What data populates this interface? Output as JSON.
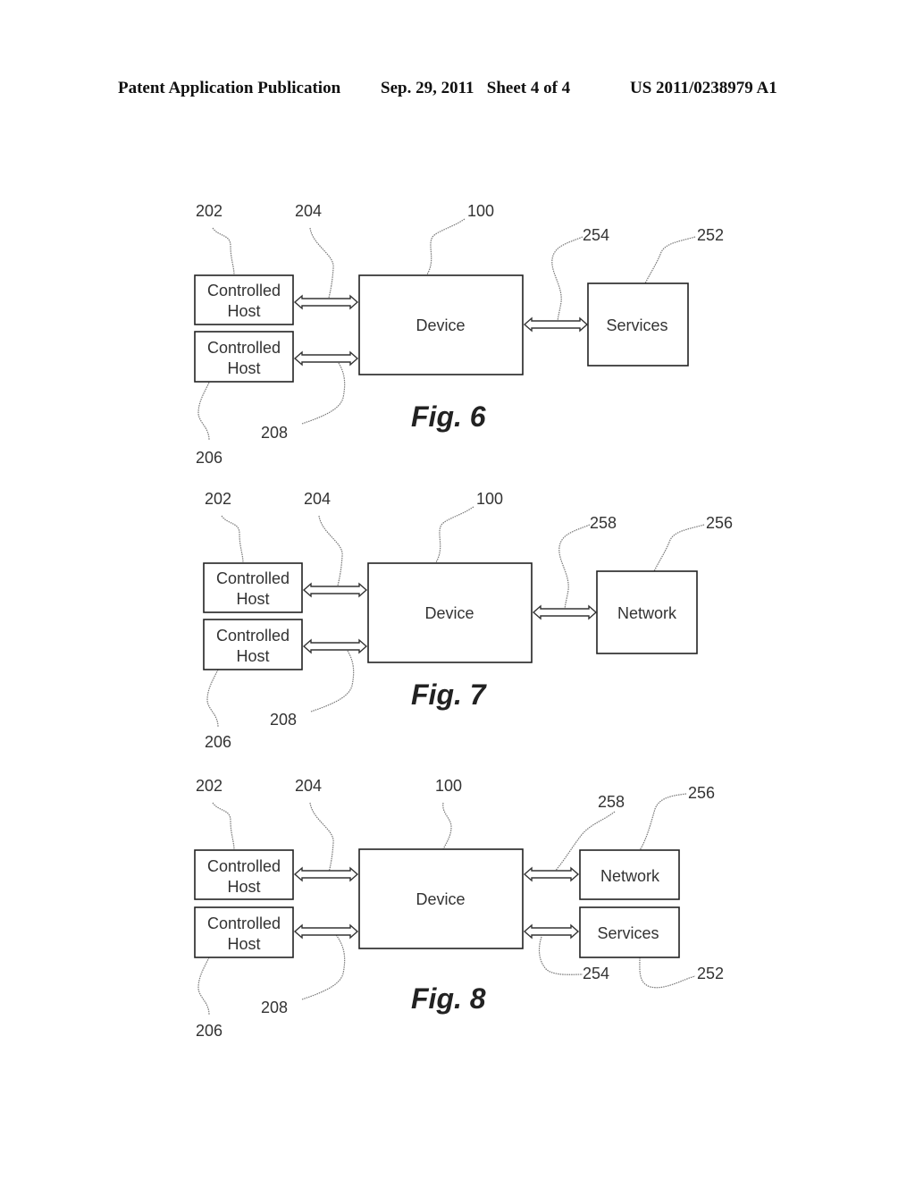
{
  "header": {
    "publication": "Patent Application Publication",
    "date_sheet": "Sep. 29, 2011   Sheet 4 of 4",
    "number": "US 2011/0238979 A1"
  },
  "figures": [
    {
      "caption": "Fig. 6",
      "boxes": {
        "host_top": [
          "Controlled",
          "Host"
        ],
        "host_bottom": [
          "Controlled",
          "Host"
        ],
        "device": "Device",
        "right": [
          "Services"
        ]
      },
      "refs": {
        "host_top": "202",
        "link_top": "204",
        "device": "100",
        "host_bottom": "206",
        "link_bottom": "208",
        "right_link": "254",
        "right_box": "252"
      }
    },
    {
      "caption": "Fig. 7",
      "boxes": {
        "host_top": [
          "Controlled",
          "Host"
        ],
        "host_bottom": [
          "Controlled",
          "Host"
        ],
        "device": "Device",
        "right": [
          "Network"
        ]
      },
      "refs": {
        "host_top": "202",
        "link_top": "204",
        "device": "100",
        "host_bottom": "206",
        "link_bottom": "208",
        "right_link": "258",
        "right_box": "256"
      }
    },
    {
      "caption": "Fig. 8",
      "boxes": {
        "host_top": [
          "Controlled",
          "Host"
        ],
        "host_bottom": [
          "Controlled",
          "Host"
        ],
        "device": "Device",
        "right": [
          "Network",
          "Services"
        ]
      },
      "refs": {
        "host_top": "202",
        "link_top": "204",
        "device": "100",
        "host_bottom": "206",
        "link_bottom": "208",
        "right_link": "258",
        "right_box": "256",
        "right_link_2": "254",
        "right_box_2": "252"
      }
    }
  ]
}
